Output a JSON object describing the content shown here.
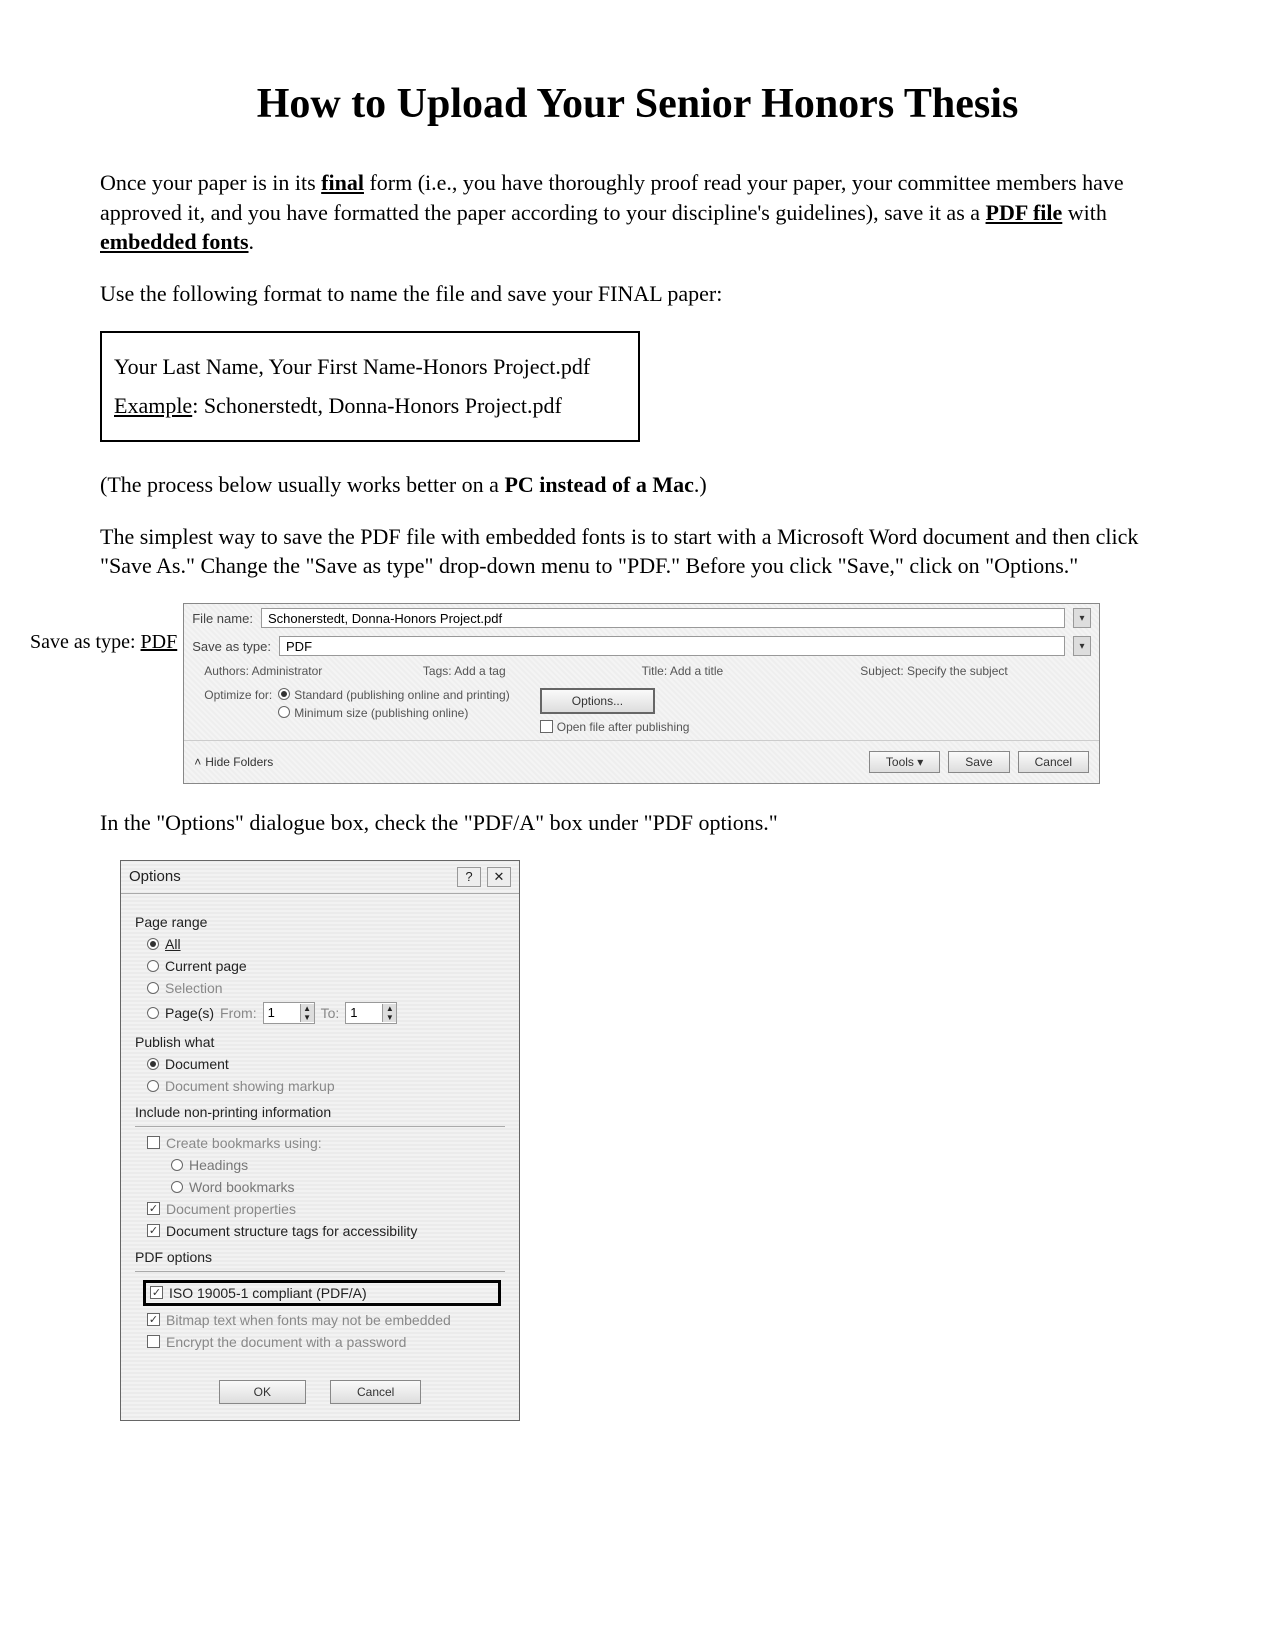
{
  "title": "How to Upload Your Senior Honors Thesis",
  "intro": {
    "p1_a": "Once your paper is in its ",
    "p1_final": "final",
    "p1_b": " form (i.e., you have thoroughly proof read your paper, your committee members have approved it, and you have formatted the paper according to your discipline's guidelines), save it as a ",
    "p1_pdf": "PDF file",
    "p1_c": " with ",
    "p1_fonts": "embedded fonts",
    "p1_d": "."
  },
  "format_instruction": "Use the following format to name the file and save your FINAL paper:",
  "filename_box": {
    "pattern": "Your Last Name, Your First Name-Honors Project.pdf",
    "example_label": "Example",
    "example_value": ": Schonerstedt, Donna-Honors Project.pdf"
  },
  "note_pc_a": "(The process below usually works better on a ",
  "note_pc_bold": "PC instead of a Mac",
  "note_pc_b": ".)",
  "instructions_saveas": "The simplest way to save the PDF file with embedded fonts is to start with a Microsoft Word document and then click \"Save As.\" Change the \"Save as type\" drop-down menu to \"PDF.\" Before you click \"Save,\" click on \"Options.\"",
  "saveas_label_a": "Save as type: ",
  "saveas_label_u": "PDF",
  "saveas_dialog": {
    "filename_label": "File name:",
    "filename_value": "Schonerstedt, Donna-Honors Project.pdf",
    "saveastype_label": "Save as type:",
    "saveastype_value": "PDF",
    "authors_label": "Authors:",
    "authors_value": "Administrator",
    "tags_label": "Tags:",
    "tags_value": "Add a tag",
    "title_label": "Title:",
    "title_value": "Add a title",
    "subject_label": "Subject:",
    "subject_value": "Specify the subject",
    "optimize_label": "Optimize for:",
    "opt_standard": "Standard (publishing online and printing)",
    "opt_minimum": "Minimum size (publishing online)",
    "options_btn": "Options...",
    "open_after": "Open file after publishing",
    "hide_folders": "Hide Folders",
    "tools": "Tools",
    "save": "Save",
    "cancel": "Cancel"
  },
  "instructions_options": "In the \"Options\" dialogue box, check the \"PDF/A\" box under \"PDF options.\"",
  "options_dialog": {
    "title": "Options",
    "page_range": {
      "label": "Page range",
      "all": "All",
      "current": "Current page",
      "selection": "Selection",
      "pages": "Page(s)",
      "from_label": "From:",
      "from_val": "1",
      "to_label": "To:",
      "to_val": "1"
    },
    "publish_what": {
      "label": "Publish what",
      "document": "Document",
      "markup": "Document showing markup"
    },
    "nonprinting": {
      "label": "Include non-printing information",
      "bookmarks": "Create bookmarks using:",
      "headings": "Headings",
      "word_bookmarks": "Word bookmarks",
      "doc_properties": "Document properties",
      "structure_tags": "Document structure tags for accessibility"
    },
    "pdf_options": {
      "label": "PDF options",
      "pdfa": "ISO 19005-1 compliant (PDF/A)",
      "bitmap": "Bitmap text when fonts may not be embedded",
      "encrypt": "Encrypt the document with a password"
    },
    "ok": "OK",
    "cancel": "Cancel"
  }
}
